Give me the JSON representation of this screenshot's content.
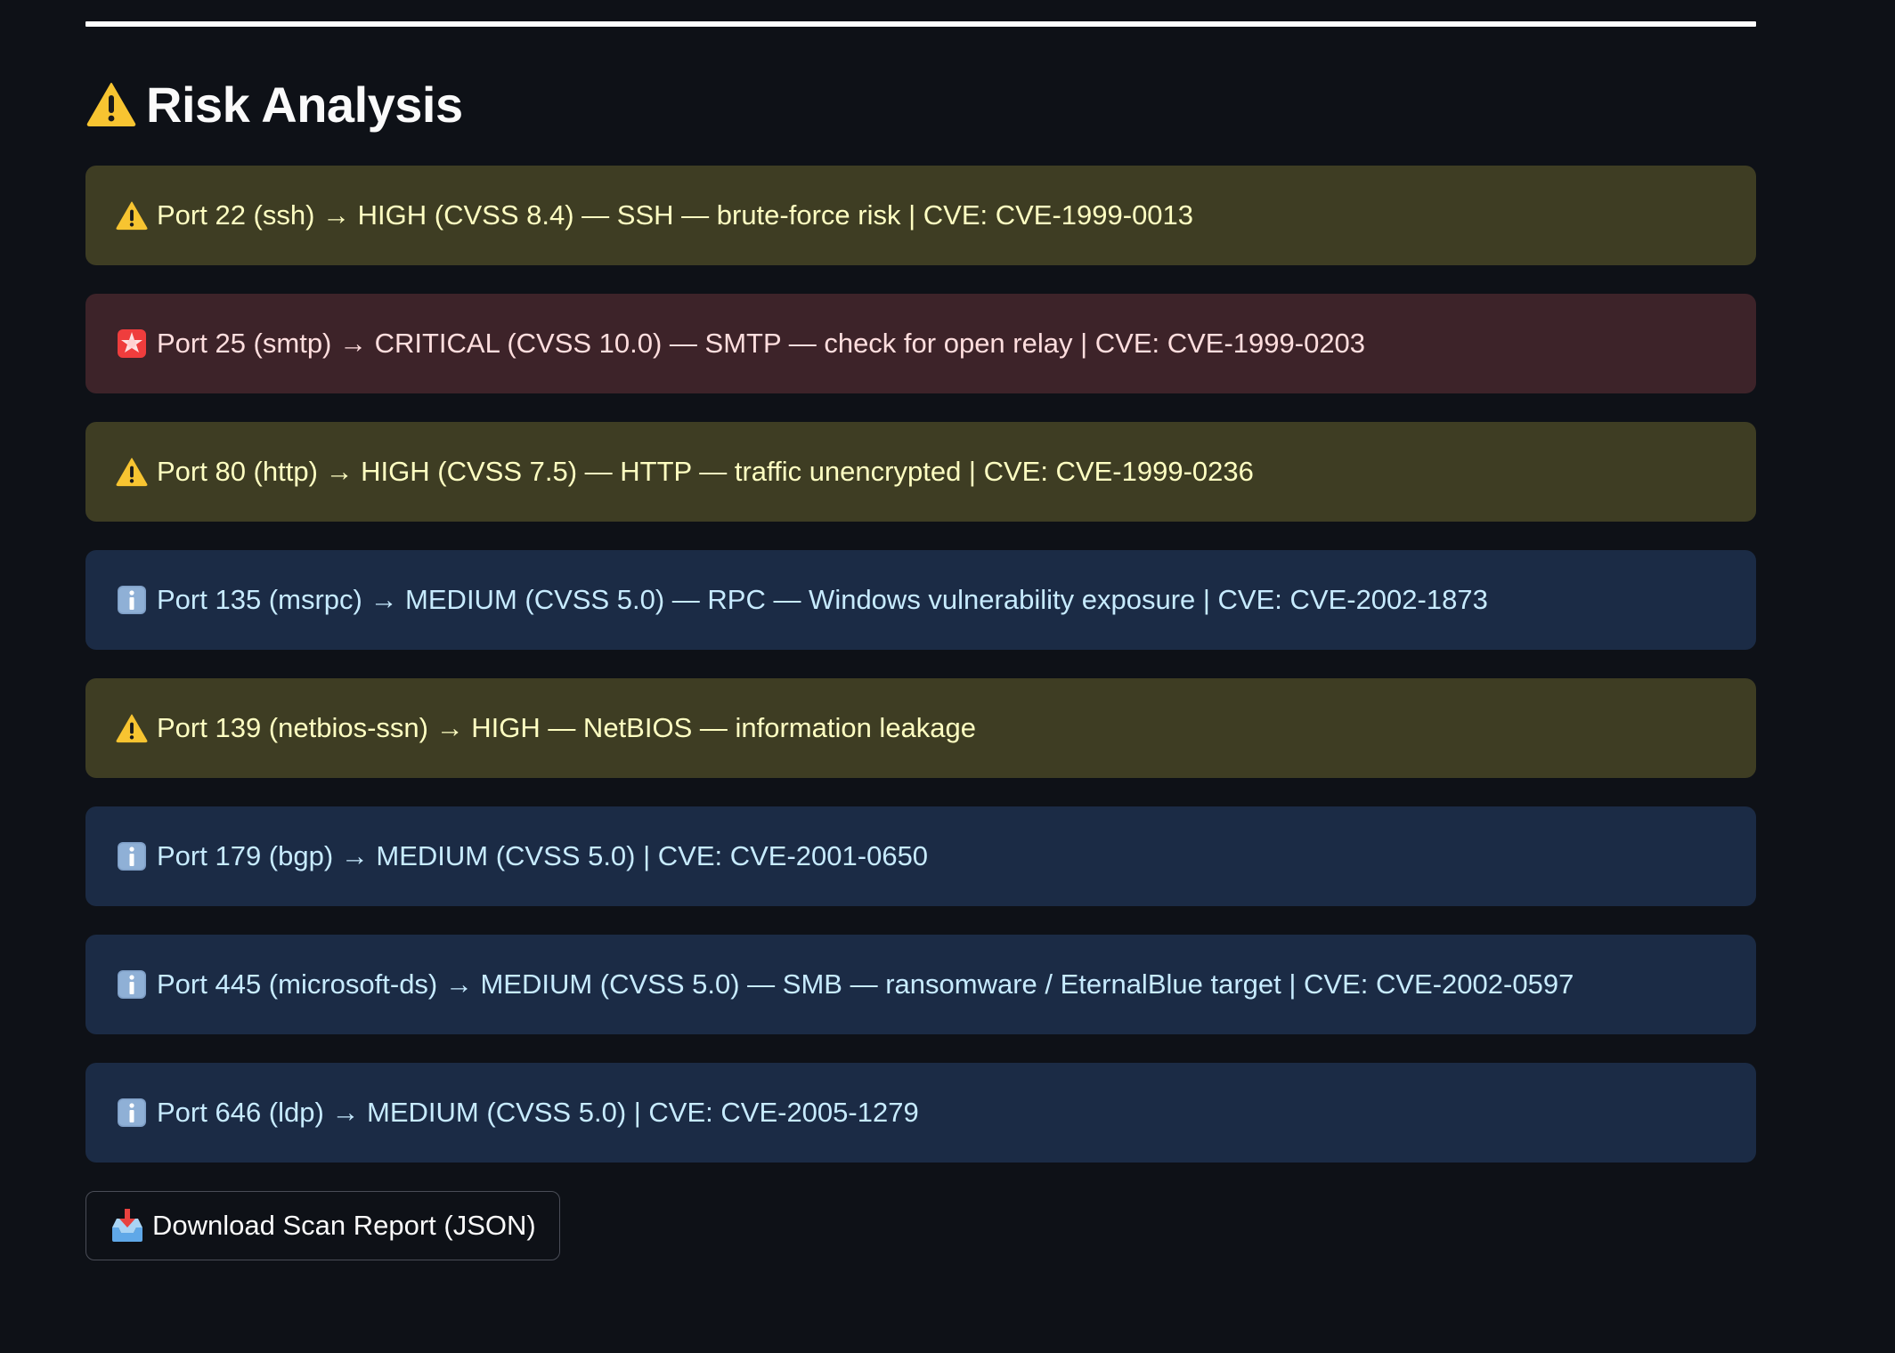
{
  "section": {
    "heading": "Risk Analysis",
    "heading_icon": "warning-icon"
  },
  "alerts": [
    {
      "severity": "high",
      "icon": "warning-icon",
      "text": "Port 22 (ssh) → HIGH (CVSS 8.4) — SSH — brute-force risk | CVE: CVE-1999-0013"
    },
    {
      "severity": "critical",
      "icon": "siren-icon",
      "text": "Port 25 (smtp) → CRITICAL (CVSS 10.0) — SMTP — check for open relay | CVE: CVE-1999-0203"
    },
    {
      "severity": "high",
      "icon": "warning-icon",
      "text": "Port 80 (http) → HIGH (CVSS 7.5) — HTTP — traffic unencrypted | CVE: CVE-1999-0236"
    },
    {
      "severity": "medium",
      "icon": "info-icon",
      "text": "Port 135 (msrpc) → MEDIUM (CVSS 5.0) — RPC — Windows vulnerability exposure | CVE: CVE-2002-1873"
    },
    {
      "severity": "high",
      "icon": "warning-icon",
      "text": "Port 139 (netbios-ssn) → HIGH — NetBIOS — information leakage"
    },
    {
      "severity": "medium",
      "icon": "info-icon",
      "text": "Port 179 (bgp) → MEDIUM (CVSS 5.0) | CVE: CVE-2001-0650"
    },
    {
      "severity": "medium",
      "icon": "info-icon",
      "text": "Port 445 (microsoft-ds) → MEDIUM (CVSS 5.0) — SMB — ransomware / EternalBlue target | CVE: CVE-2002-0597"
    },
    {
      "severity": "medium",
      "icon": "info-icon",
      "text": "Port 646 (ldp) → MEDIUM (CVSS 5.0) | CVE: CVE-2005-1279"
    }
  ],
  "download_button": {
    "label": "Download Scan Report (JSON)",
    "icon": "inbox-tray-icon"
  },
  "colors": {
    "background": "#0e1117",
    "high_bg": "#3e3d23",
    "high_text": "#ffffc2",
    "critical_bg": "#3d2329",
    "critical_text": "#ffdede",
    "medium_bg": "#1b2b45",
    "medium_text": "#c7ebff"
  }
}
